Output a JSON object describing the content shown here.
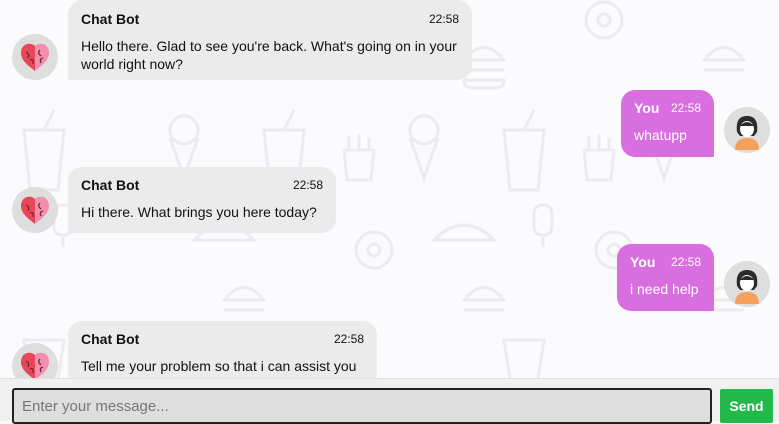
{
  "messages": [
    {
      "role": "bot",
      "sender": "Chat Bot",
      "time": "22:58",
      "text": "Hello there. Glad to see you're back. What's going on in your world right now?"
    },
    {
      "role": "user",
      "sender": "You",
      "time": "22:58",
      "text": "whatupp"
    },
    {
      "role": "bot",
      "sender": "Chat Bot",
      "time": "22:58",
      "text": "Hi there. What brings you here today?"
    },
    {
      "role": "user",
      "sender": "You",
      "time": "22:58",
      "text": "i need help"
    },
    {
      "role": "bot",
      "sender": "Chat Bot",
      "time": "22:58",
      "text": "Tell me your problem so that i can assist you"
    }
  ],
  "composer": {
    "placeholder": "Enter your message...",
    "send_label": "Send"
  },
  "colors": {
    "user_bubble": "#d96ee0",
    "bot_bubble": "#ebebeb",
    "send_button": "#22b84a"
  },
  "icons": {
    "bot_avatar": "brain-heart-icon",
    "user_avatar": "user-woman-icon"
  }
}
